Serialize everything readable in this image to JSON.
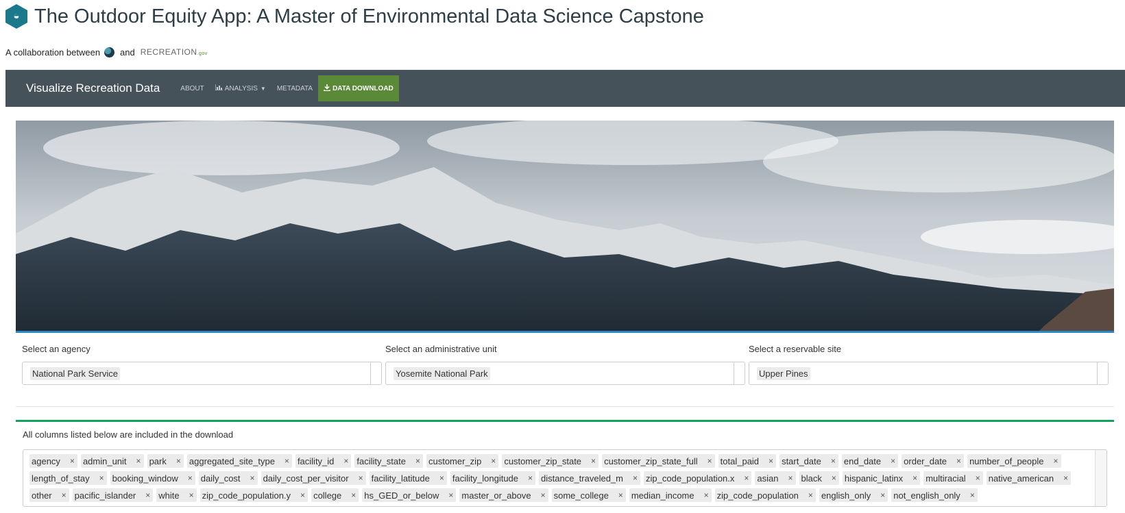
{
  "header": {
    "title": "The Outdoor Equity App: A Master of Environmental Data Science Capstone",
    "logo_icon": "hexagon-logo-icon",
    "collab_prefix": "A collaboration between",
    "collab_and": "and",
    "partner_logo_text": "RECREATION",
    "partner_logo_suffix": ".gov"
  },
  "navbar": {
    "brand": "Visualize Recreation Data",
    "items": [
      {
        "label": "ABOUT",
        "icon": ""
      },
      {
        "label": "ANALYSIS",
        "icon": "bar-chart-icon",
        "dropdown": true
      },
      {
        "label": "METADATA",
        "icon": ""
      },
      {
        "label": "DATA DOWNLOAD",
        "icon": "download-icon",
        "active": true
      }
    ],
    "colors": {
      "bar": "#46525a",
      "download": "#5a8a38"
    }
  },
  "filters": {
    "agency": {
      "label": "Select an agency",
      "value": "National Park Service"
    },
    "admin_unit": {
      "label": "Select an administrative unit",
      "value": "Yosemite National Park"
    },
    "site": {
      "label": "Select a reservable site",
      "value": "Upper Pines"
    }
  },
  "columns": {
    "label": "All columns listed below are included in the download",
    "tags": [
      "agency",
      "admin_unit",
      "park",
      "aggregated_site_type",
      "facility_id",
      "facility_state",
      "customer_zip",
      "customer_zip_state",
      "customer_zip_state_full",
      "total_paid",
      "start_date",
      "end_date",
      "order_date",
      "number_of_people",
      "length_of_stay",
      "booking_window",
      "daily_cost",
      "daily_cost_per_visitor",
      "facility_latitude",
      "facility_longitude",
      "distance_traveled_m",
      "zip_code_population.x",
      "asian",
      "black",
      "hispanic_latinx",
      "multiracial",
      "native_american",
      "other",
      "pacific_islander",
      "white",
      "zip_code_population.y",
      "college",
      "hs_GED_or_below",
      "master_or_above",
      "some_college",
      "median_income",
      "zip_code_population",
      "english_only",
      "not_english_only"
    ],
    "remove_symbol": "×"
  },
  "colors": {
    "accent_green": "#16a05d",
    "accent_blue": "#2b88c8"
  }
}
